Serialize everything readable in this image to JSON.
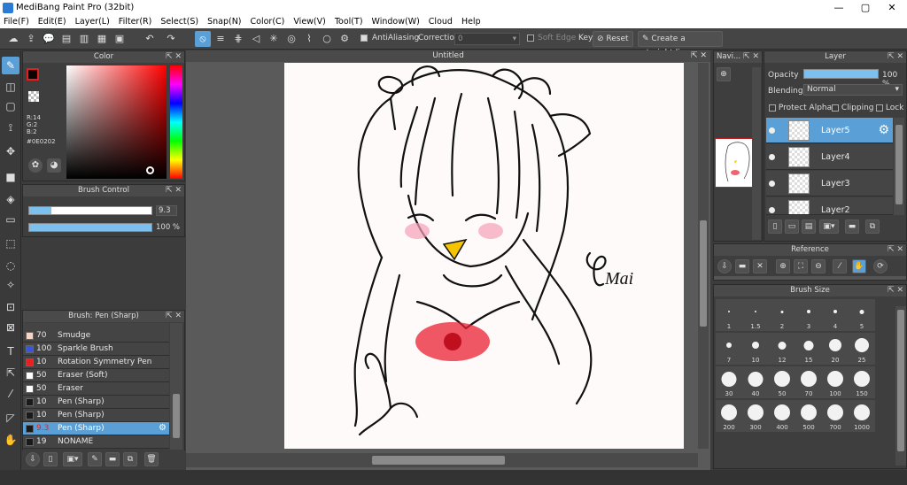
{
  "window": {
    "title": "MediBang Paint Pro (32bit)",
    "min": "—",
    "max": "▢",
    "close": "✕"
  },
  "menu": [
    "File(F)",
    "Edit(E)",
    "Layer(L)",
    "Filter(R)",
    "Select(S)",
    "Snap(N)",
    "Color(C)",
    "View(V)",
    "Tool(T)",
    "Window(W)",
    "Cloud",
    "Help"
  ],
  "toolbar": {
    "antialiasing_label": "AntiAliasing",
    "correction_label": "Correction",
    "correction_value": "0",
    "soft_edge_label": "Soft Edge",
    "key_label": "Key",
    "reset_label": "Reset",
    "straight_line_label": "Create a straight line"
  },
  "color_panel": {
    "title": "Color",
    "r": "R:14",
    "g": "G:2",
    "b": "B:2",
    "hex": "#0E0202",
    "current_color": "#0e0202"
  },
  "brush_control": {
    "title": "Brush Control",
    "size_value": "9.3",
    "opacity_value": "100 %",
    "size_fraction": 0.18,
    "opacity_fraction": 1.0
  },
  "brush_panel": {
    "title": "Brush: Pen (Sharp)",
    "items": [
      {
        "size": "70",
        "name": "Smudge",
        "color": "#f3d6c8"
      },
      {
        "size": "100",
        "name": "Sparkle Brush",
        "color": "#3a55d8"
      },
      {
        "size": "10",
        "name": "Rotation Symmetry Pen",
        "color": "#e82020"
      },
      {
        "size": "50",
        "name": "Eraser (Soft)",
        "color": "#ffffff"
      },
      {
        "size": "50",
        "name": "Eraser",
        "color": "#ffffff"
      },
      {
        "size": "10",
        "name": "Pen (Sharp)",
        "color": "#1a1a1a"
      },
      {
        "size": "10",
        "name": "Pen (Sharp)",
        "color": "#1a1a1a"
      },
      {
        "size": "9.3",
        "name": "Pen (Sharp)",
        "color": "#1a1a1a"
      },
      {
        "size": "19",
        "name": "NONAME",
        "color": "#1a1a1a"
      }
    ]
  },
  "canvas": {
    "tab_title": "Untitled",
    "signature": "Mai"
  },
  "navigator": {
    "title": "Navi..."
  },
  "layer_panel": {
    "title": "Layer",
    "opacity_label": "Opacity",
    "opacity_value": "100 %",
    "opacity_fraction": 1.0,
    "blending_label": "Blending",
    "blending_value": "Normal",
    "protect_alpha": "Protect Alpha",
    "clipping": "Clipping",
    "lock": "Lock",
    "layers": [
      "Layer5",
      "Layer4",
      "Layer3",
      "Layer2"
    ],
    "selected": "Layer5"
  },
  "reference_panel": {
    "title": "Reference"
  },
  "brush_size_panel": {
    "title": "Brush Size",
    "sizes": [
      "1",
      "1.5",
      "2",
      "3",
      "4",
      "5",
      "7",
      "10",
      "12",
      "15",
      "20",
      "25",
      "30",
      "40",
      "50",
      "70",
      "100",
      "150",
      "200",
      "300",
      "400",
      "500",
      "700",
      "1000"
    ]
  }
}
